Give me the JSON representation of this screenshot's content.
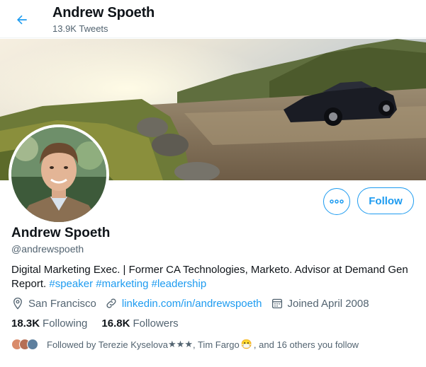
{
  "header": {
    "name": "Andrew Spoeth",
    "tweet_count": "13.9K Tweets"
  },
  "profile": {
    "name": "Andrew Spoeth",
    "handle": "@andrewspoeth",
    "bio_text": "Digital Marketing Exec. | Former CA Technologies, Marketo. Advisor at Demand Gen Report.",
    "hashtags": [
      "#speaker",
      "#marketing",
      "#leadership"
    ],
    "location": "San Francisco",
    "website": "linkedin.com/in/andrewspoeth",
    "joined": "Joined April 2008"
  },
  "actions": {
    "follow_label": "Follow"
  },
  "stats": {
    "following_count": "18.3K",
    "following_label": "Following",
    "followers_count": "16.8K",
    "followers_label": "Followers"
  },
  "followed_by": {
    "prefix": "Followed by Terezie Kyselova",
    "stars": "★★★",
    "middle": ", Tim Fargo",
    "emoji": "😷",
    "suffix": ", and 16 others you follow"
  },
  "colors": {
    "accent": "#1d9bf0",
    "text_primary": "#0f1419",
    "text_secondary": "#536471"
  }
}
